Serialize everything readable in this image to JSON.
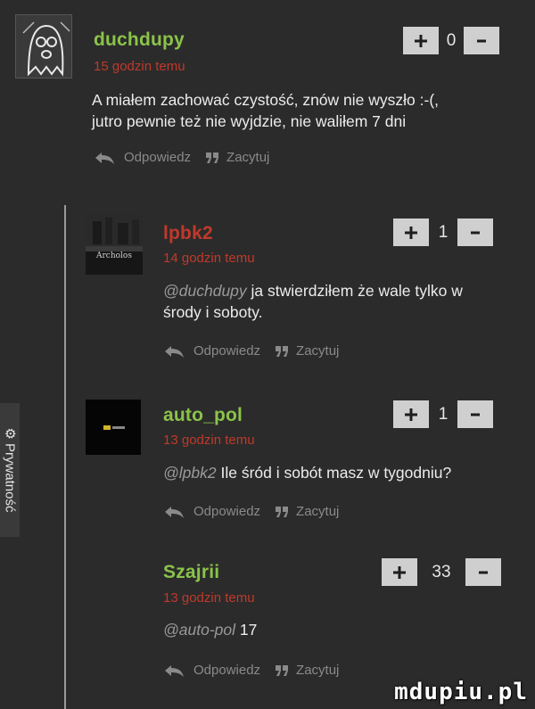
{
  "comments": [
    {
      "username": "duchdupy",
      "username_color": "#8bc34a",
      "time": "15 godzin temu",
      "text_lines": [
        "A miałem zachować czystość, znów nie wyszło :-(,",
        "jutro pewnie też nie wyjdzie, nie waliłem 7 dni"
      ],
      "votes": "0",
      "reply_label": "Odpowiedz",
      "quote_label": "Zacytuj"
    },
    {
      "username": "lpbk2",
      "username_color": "#c0392b",
      "time": "14 godzin temu",
      "mention": "@duchdupy",
      "text_lines": [
        " ja stwierdziłem że wale tylko w",
        "środy i soboty."
      ],
      "votes": "1",
      "reply_label": "Odpowiedz",
      "quote_label": "Zacytuj",
      "avatar_text": "Archolos"
    },
    {
      "username": "auto_pol",
      "username_color": "#8bc34a",
      "time": "13 godzin temu",
      "mention": "@lpbk2",
      "text_lines": [
        " Ile śród i sobót masz w tygodniu?"
      ],
      "votes": "1",
      "reply_label": "Odpowiedz",
      "quote_label": "Zacytuj"
    },
    {
      "username": "Szajrii",
      "username_color": "#8bc34a",
      "time": "13 godzin temu",
      "mention": "@auto-pol",
      "text_lines": [
        " 17"
      ],
      "votes": "33",
      "reply_label": "Odpowiedz",
      "quote_label": "Zacytuj"
    }
  ],
  "side_tab": {
    "label": "Prywatność"
  },
  "watermark": "mdupiu.pl"
}
